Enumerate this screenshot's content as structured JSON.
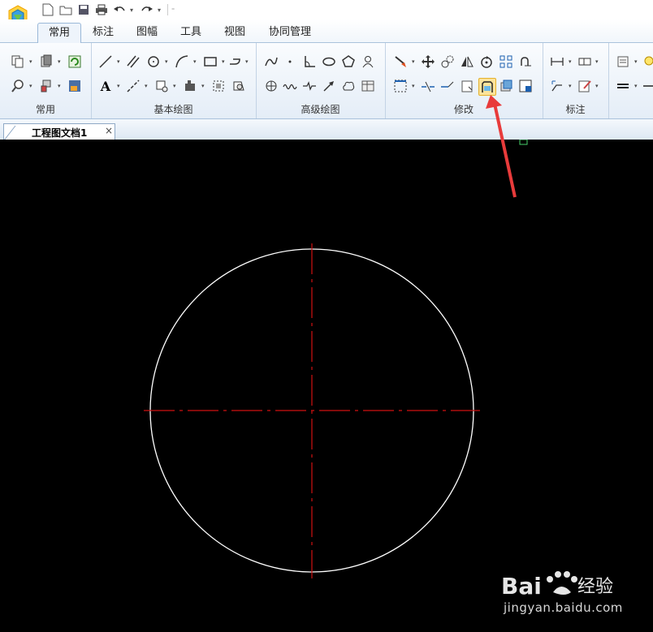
{
  "quick_access": {
    "icons": [
      "new-file-icon",
      "open-folder-icon",
      "save-icon",
      "print-icon",
      "undo-icon",
      "redo-icon"
    ]
  },
  "tabs": [
    {
      "label": "常用",
      "active": true
    },
    {
      "label": "标注"
    },
    {
      "label": "图幅"
    },
    {
      "label": "工具"
    },
    {
      "label": "视图"
    },
    {
      "label": "协同管理"
    }
  ],
  "ribbon": {
    "groups": {
      "common": "常用",
      "basic_draw": "基本绘图",
      "advanced_draw": "高级绘图",
      "modify": "修改",
      "annotate": "标注"
    }
  },
  "document": {
    "tab_label": "工程图文档1",
    "close": "×"
  },
  "drawing": {
    "circle_color": "#ffffff",
    "centerline_color": "#d01010",
    "background": "#000000"
  },
  "annotation": {
    "arrow_color": "#e83b3b"
  },
  "watermark": {
    "brand": "Bai",
    "brand2": "经验",
    "url": "jingyan.baidu.com"
  }
}
